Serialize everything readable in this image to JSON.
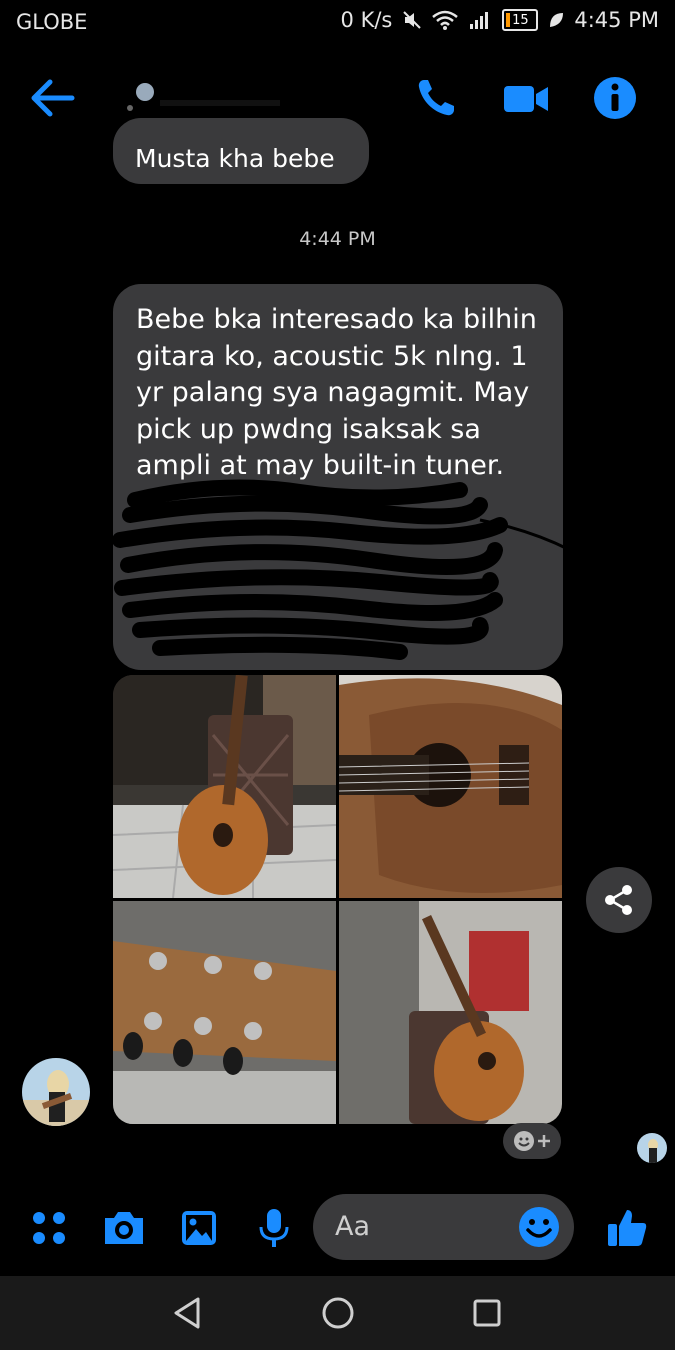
{
  "status_bar": {
    "carrier": "GLOBE",
    "net_speed": "0 K/s",
    "battery_level": "15",
    "time": "4:45 PM"
  },
  "header": {
    "back_icon": "arrow-left-icon",
    "call_icon": "phone-icon",
    "video_icon": "video-camera-icon",
    "info_icon": "info-icon",
    "accent_color": "#1a8cff"
  },
  "conversation": {
    "previous_message": "Musta kha bebe",
    "timestamp": "4:44 PM",
    "main_message": "Bebe bka interesado ka bilhin\ngitara ko, acoustic 5k nlng. 1\nyr palang sya nagagmit. May\npick up pwdng isaksak sa\nampli at may built-in tuner.",
    "photos": [
      "acoustic-guitar-leaning-on-chair",
      "guitar-body-closeup",
      "guitar-headstock-tuners",
      "guitar-near-chair-in-room"
    ]
  },
  "composer": {
    "icons": [
      "apps-icon",
      "camera-icon",
      "gallery-icon",
      "microphone-icon",
      "like-icon"
    ],
    "input_placeholder": "Aa"
  },
  "nav": {
    "icons": [
      "back-triangle-icon",
      "home-circle-icon",
      "recents-square-icon"
    ]
  }
}
